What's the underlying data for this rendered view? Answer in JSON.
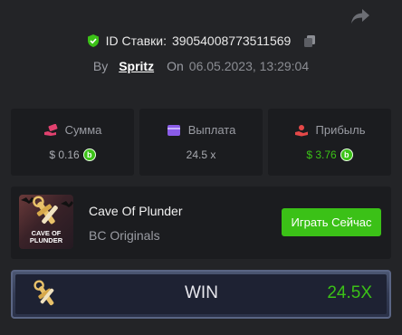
{
  "header": {
    "share_icon": "share-arrow-icon",
    "bet_id_label": "ID Ставки:",
    "bet_id": "39054008773511569",
    "by_label": "By",
    "username": "Spritz",
    "on_label": "On",
    "datetime": "06.05.2023, 13:29:04"
  },
  "stats": {
    "amount": {
      "label": "Сумма",
      "value": "$ 0.16",
      "icon": "money-hand-icon"
    },
    "payout": {
      "label": "Выплата",
      "value": "24.5 x",
      "icon": "wallet-icon"
    },
    "profit": {
      "label": "Прибыль",
      "value": "$ 3.76",
      "icon": "profit-hand-icon"
    },
    "coin_symbol": "b"
  },
  "game": {
    "thumb_text": "CAVE OF PLUNDER",
    "title": "Cave Of Plunder",
    "provider": "BC Originals",
    "play_label": "Играть Сейчас"
  },
  "result": {
    "label": "WIN",
    "multiplier": "24.5X"
  },
  "colors": {
    "background": "#232427",
    "panel": "#1b1c1f",
    "accent_green": "#3bc117",
    "pink": "#e2416f",
    "purple": "#8a5ce8",
    "red": "#e54848"
  }
}
